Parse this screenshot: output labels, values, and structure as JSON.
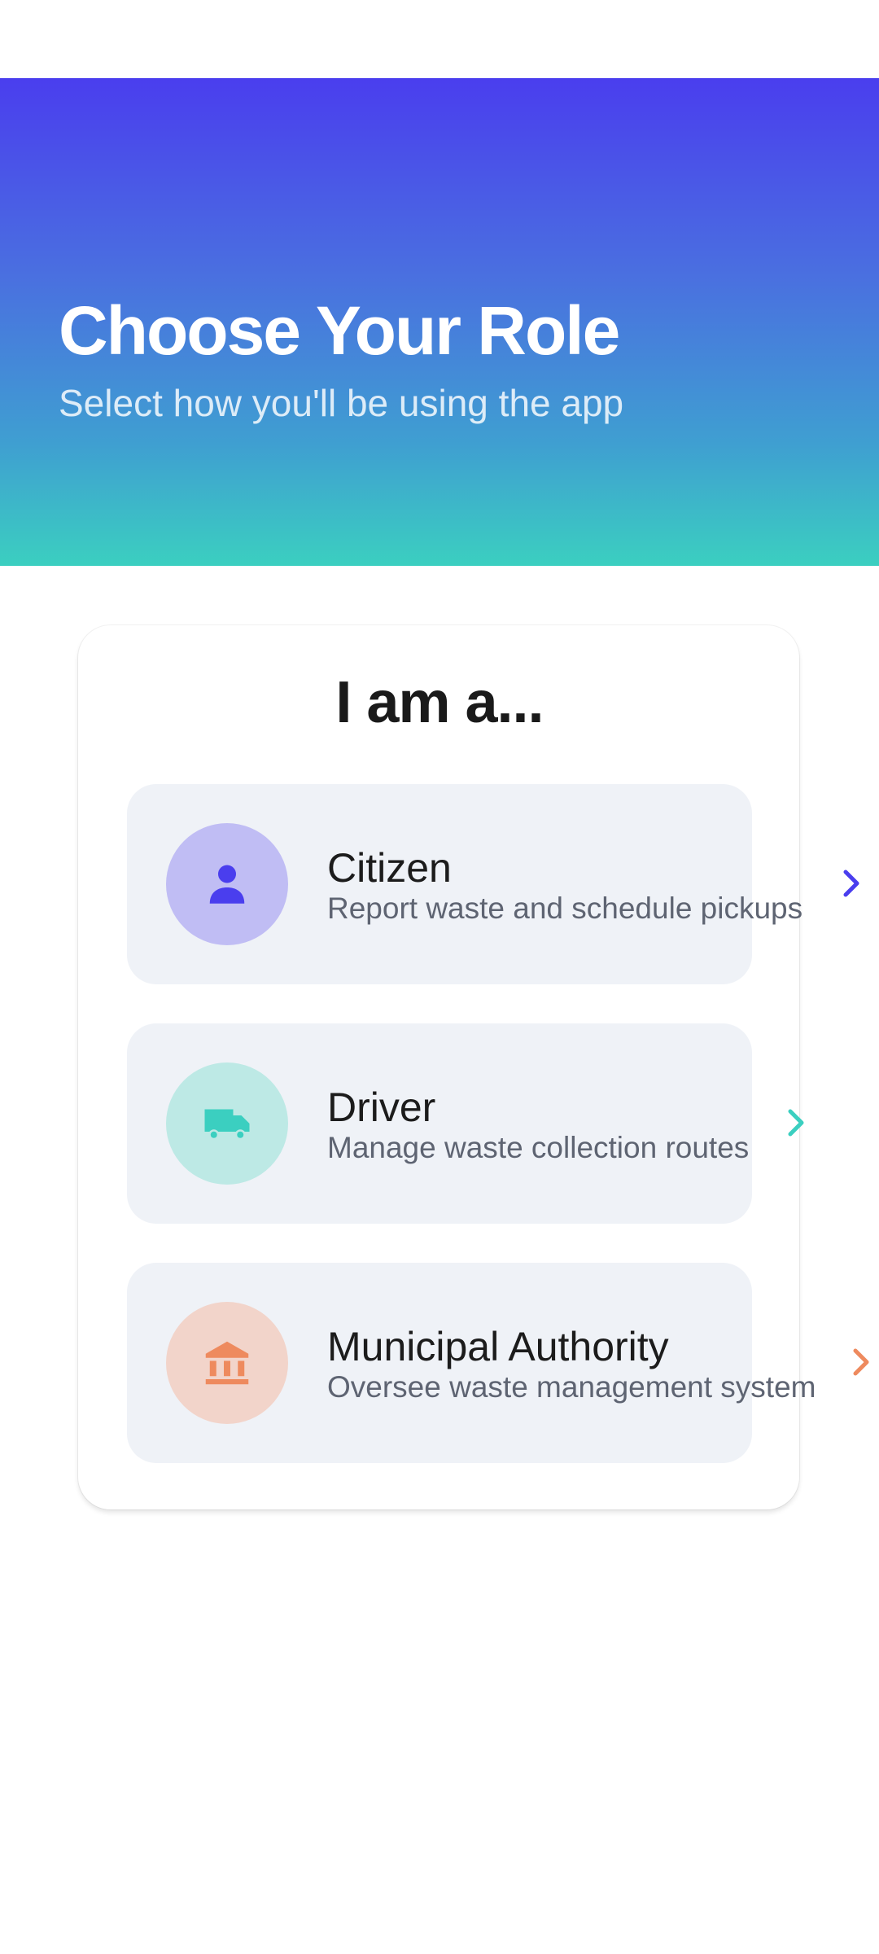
{
  "header": {
    "title": "Choose Your Role",
    "subtitle": "Select how you'll be using the app"
  },
  "panel": {
    "heading": "I am a..."
  },
  "roles": [
    {
      "title": "Citizen",
      "description": "Report waste and schedule pickups",
      "icon": "person-icon",
      "accent": "#4a3eee",
      "bg": "#c0bdf4"
    },
    {
      "title": "Driver",
      "description": "Manage waste collection routes",
      "icon": "truck-icon",
      "accent": "#3bcfc0",
      "bg": "#bde9e5"
    },
    {
      "title": "Municipal Authority",
      "description": "Oversee waste management system",
      "icon": "bank-icon",
      "accent": "#ee8a5e",
      "bg": "#f2d4ca"
    }
  ]
}
